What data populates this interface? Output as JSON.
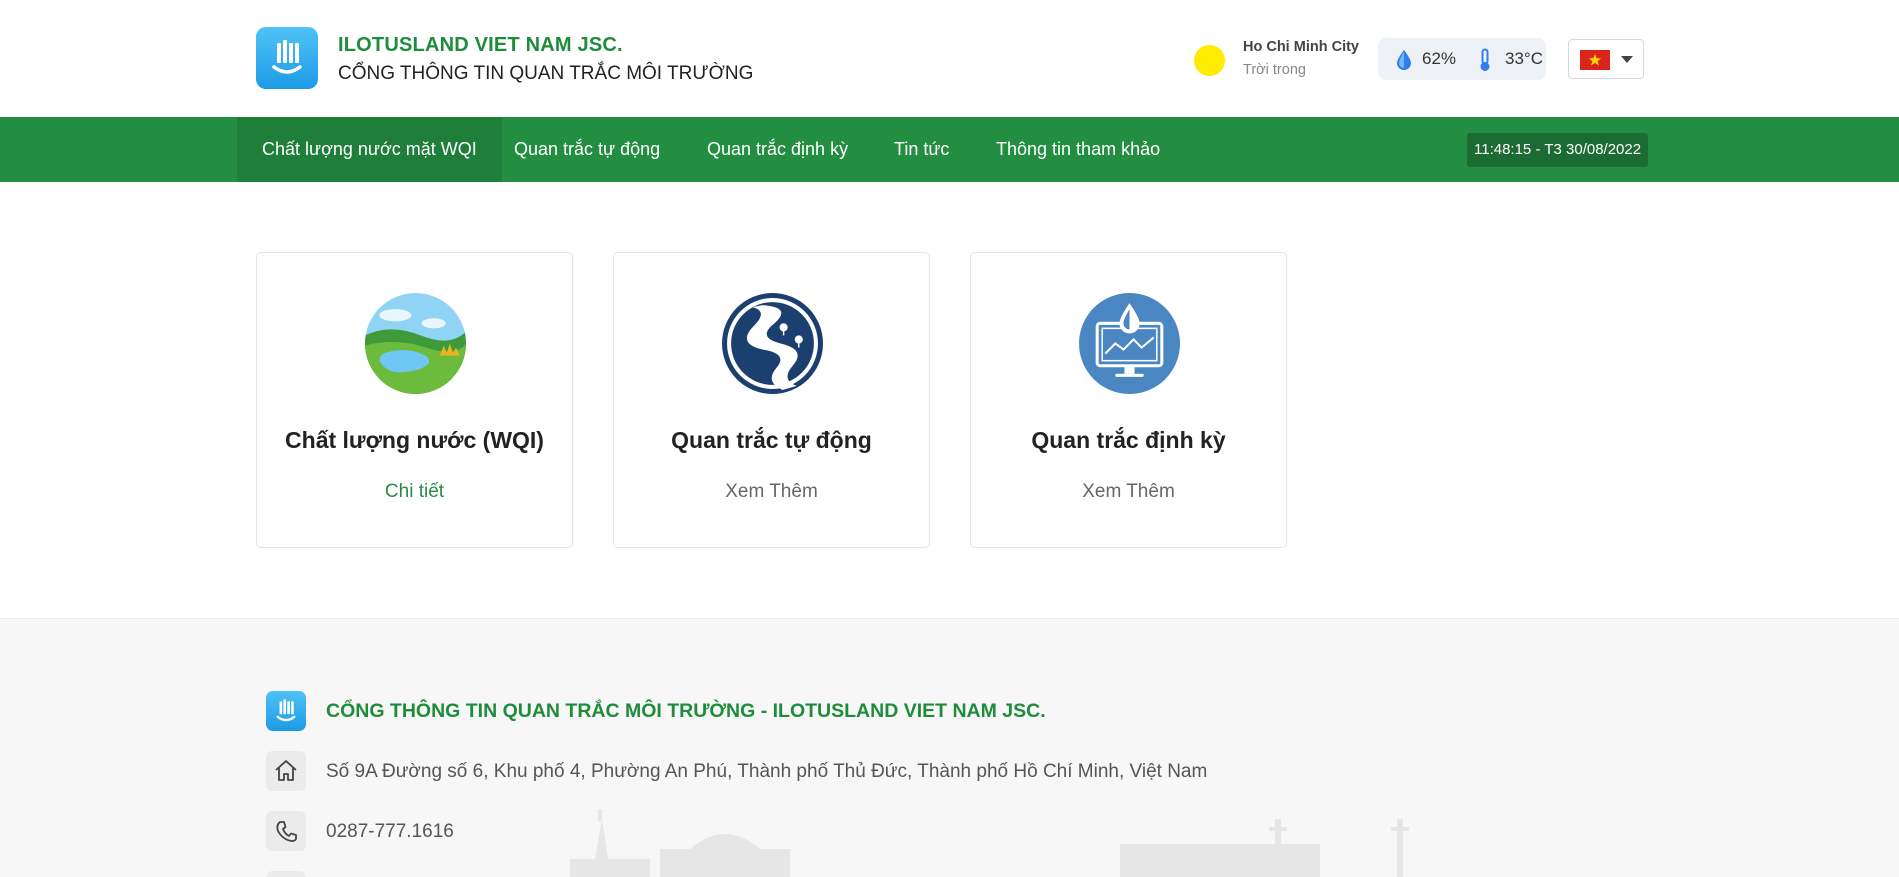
{
  "header": {
    "brand_name": "ILOTUSLAND VIET NAM JSC.",
    "brand_sub": "CỔNG THÔNG TIN QUAN TRẮC MÔI TRƯỜNG",
    "weather": {
      "city": "Ho Chi Minh City",
      "condition": "Trời trong",
      "humidity": "62%",
      "temperature": "33°C"
    },
    "language": "vi"
  },
  "nav": {
    "items": [
      {
        "label": "Chất lượng nước mặt WQI"
      },
      {
        "label": "Quan trắc tự động"
      },
      {
        "label": "Quan trắc định kỳ"
      },
      {
        "label": "Tin tức"
      },
      {
        "label": "Thông tin tham khảo"
      }
    ],
    "clock": "11:48:15 - T3 30/08/2022"
  },
  "cards": [
    {
      "title": "Chất lượng nước (WQI)",
      "link": "Chi tiết",
      "icon": "landscape-icon"
    },
    {
      "title": "Quan trắc tự động",
      "link": "Xem Thêm",
      "icon": "river-icon"
    },
    {
      "title": "Quan trắc định kỳ",
      "link": "Xem Thêm",
      "icon": "monitor-water-icon"
    }
  ],
  "footer": {
    "title": "CỔNG THÔNG TIN QUAN TRẮC MÔI TRƯỜNG - ILOTUSLAND VIET NAM JSC.",
    "address": "Số 9A Đường số 6, Khu phố 4, Phường An Phú, Thành phố Thủ Đức, Thành phố Hồ Chí Minh, Việt Nam",
    "phone": "0287-777.1616"
  },
  "colors": {
    "brand_green": "#238e42",
    "brand_blue": "#1e9be6",
    "sun_yellow": "#ffec00"
  }
}
